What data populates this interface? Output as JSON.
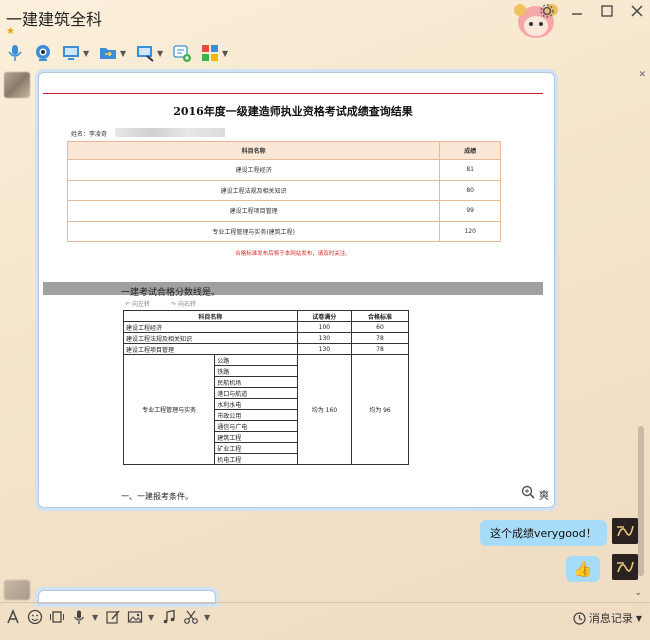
{
  "window": {
    "title": "一建建筑全科",
    "star": "★"
  },
  "toolbar": {
    "items": [
      "voice-icon",
      "video-icon",
      "share-screen-icon",
      "file-transfer-icon",
      "remote-desktop-icon",
      "add-chat-icon",
      "apps-icon"
    ]
  },
  "document": {
    "title": "2016年度一级建造师执业资格考试成绩查询结果",
    "name_label": "姓名：李凌奇",
    "score_table": {
      "headers": [
        "科目名称",
        "成绩"
      ],
      "rows": [
        [
          "建设工程经济",
          "81"
        ],
        [
          "建设工程法规及相关知识",
          "80"
        ],
        [
          "建设工程项目管理",
          "99"
        ],
        [
          "专业工程管理与实务(建筑工程)",
          "120"
        ]
      ]
    },
    "notice": "合格标准发布后将于本网站发布，请及时关注。",
    "pass_section_title": "一建考试合格分数线是。",
    "rotate_left": "向左转",
    "rotate_right": "向右转",
    "pass_table": {
      "headers": [
        "科目名称",
        "试卷满分",
        "合格标准"
      ],
      "rows": [
        [
          "建设工程经济",
          "100",
          "60"
        ],
        [
          "建设工程法规及相关知识",
          "130",
          "78"
        ],
        [
          "建设工程项目管理",
          "130",
          "78"
        ]
      ],
      "practice_label": "专业工程管理与实务",
      "practice_subjects": [
        "公路",
        "铁路",
        "民航机场",
        "港口与航道",
        "水利水电",
        "市政公用",
        "通信与广电",
        "建筑工程",
        "矿业工程",
        "机电工程"
      ],
      "practice_full": "均为 160",
      "practice_pass": "均为 96"
    },
    "requirements": "一、一建报考条件。",
    "cut_char": "爽"
  },
  "messages": {
    "text": "这个成绩verygood！",
    "thumb": "👍"
  },
  "bottom": {
    "history_label": "消息记录"
  },
  "colors": {
    "bubble": "#a6dcf7",
    "accent_red": "#dd2222"
  }
}
